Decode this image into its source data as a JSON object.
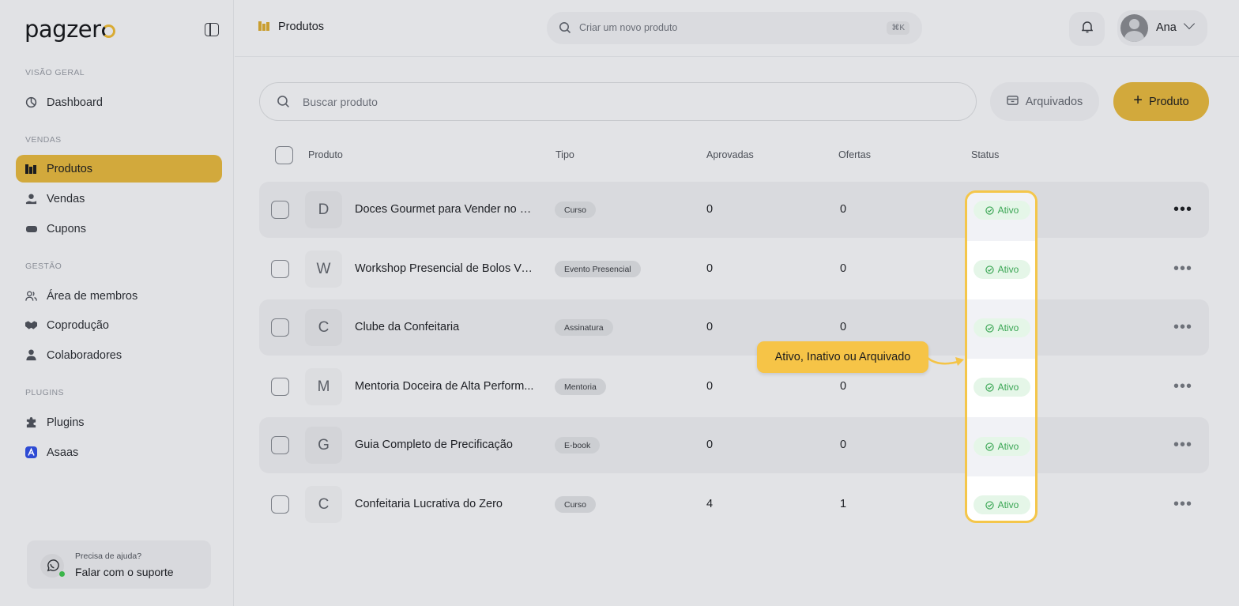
{
  "app": {
    "logo_text": "pagzer"
  },
  "sidebar": {
    "sections": [
      {
        "title": "VISÃO GERAL"
      },
      {
        "title": "VENDAS"
      },
      {
        "title": "GESTÃO"
      },
      {
        "title": "PLUGINS"
      }
    ],
    "items": [
      {
        "label": "Dashboard",
        "icon": "dashboard-icon"
      },
      {
        "label": "Produtos",
        "icon": "products-icon",
        "active": true
      },
      {
        "label": "Vendas",
        "icon": "sales-icon"
      },
      {
        "label": "Cupons",
        "icon": "coupon-icon"
      },
      {
        "label": "Área de membros",
        "icon": "members-icon"
      },
      {
        "label": "Coprodução",
        "icon": "handshake-icon"
      },
      {
        "label": "Colaboradores",
        "icon": "user-icon"
      },
      {
        "label": "Plugins",
        "icon": "puzzle-icon"
      },
      {
        "label": "Asaas",
        "icon": "asaas-icon"
      }
    ],
    "help": {
      "subtitle": "Precisa de ajuda?",
      "title": "Falar com o suporte"
    }
  },
  "topbar": {
    "breadcrumb": "Produtos",
    "search_placeholder": "Criar um novo produto",
    "shortcut": "⌘K",
    "user_name": "Ana"
  },
  "toolbar": {
    "search_placeholder": "Buscar produto",
    "archived_label": "Arquivados",
    "add_label": "Produto"
  },
  "table": {
    "headers": {
      "product": "Produto",
      "type": "Tipo",
      "approved": "Aprovadas",
      "offers": "Ofertas",
      "status": "Status"
    },
    "rows": [
      {
        "initial": "D",
        "name": "Doces Gourmet para Vender no N...",
        "type": "Curso",
        "approved": "0",
        "offers": "0",
        "status": "Ativo"
      },
      {
        "initial": "W",
        "name": "Workshop Presencial de Bolos Vu...",
        "type": "Evento Presencial",
        "approved": "0",
        "offers": "0",
        "status": "Ativo"
      },
      {
        "initial": "C",
        "name": "Clube da Confeitaria",
        "type": "Assinatura",
        "approved": "0",
        "offers": "0",
        "status": "Ativo"
      },
      {
        "initial": "M",
        "name": "Mentoria Doceira de Alta Perform...",
        "type": "Mentoria",
        "approved": "0",
        "offers": "0",
        "status": "Ativo"
      },
      {
        "initial": "G",
        "name": "Guia Completo de Precificação",
        "type": "E-book",
        "approved": "0",
        "offers": "0",
        "status": "Ativo"
      },
      {
        "initial": "C",
        "name": "Confeitaria Lucrativa do Zero",
        "type": "Curso",
        "approved": "4",
        "offers": "1",
        "status": "Ativo"
      }
    ]
  },
  "callout": {
    "text": "Ativo, Inativo ou Arquivado"
  },
  "colors": {
    "accent": "#d2a93c",
    "callout": "#f6c447",
    "status_green": "#3aa654"
  }
}
